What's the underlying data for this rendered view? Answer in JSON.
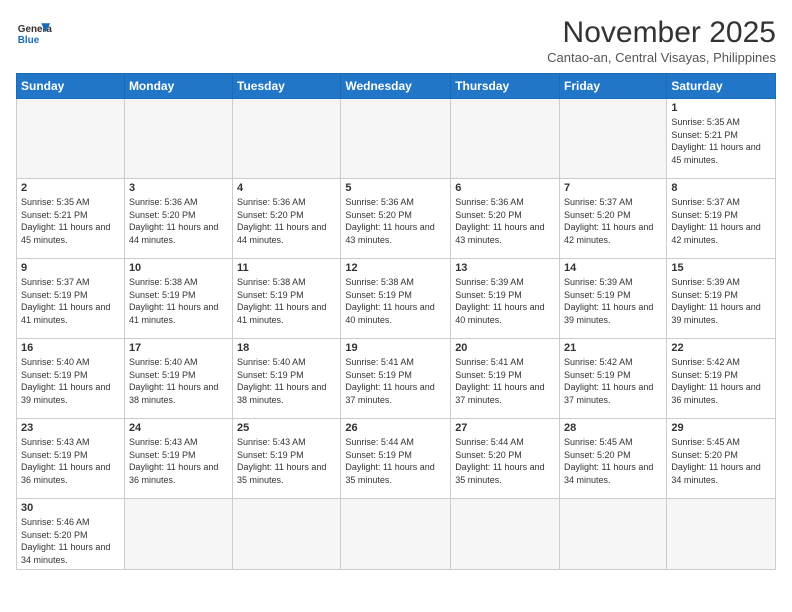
{
  "logo": {
    "line1": "General",
    "line2": "Blue"
  },
  "title": "November 2025",
  "location": "Cantao-an, Central Visayas, Philippines",
  "weekdays": [
    "Sunday",
    "Monday",
    "Tuesday",
    "Wednesday",
    "Thursday",
    "Friday",
    "Saturday"
  ],
  "days": {
    "d1": {
      "num": "1",
      "sunrise": "5:35 AM",
      "sunset": "5:21 PM",
      "daylight": "11 hours and 45 minutes."
    },
    "d2": {
      "num": "2",
      "sunrise": "5:35 AM",
      "sunset": "5:21 PM",
      "daylight": "11 hours and 45 minutes."
    },
    "d3": {
      "num": "3",
      "sunrise": "5:36 AM",
      "sunset": "5:20 PM",
      "daylight": "11 hours and 44 minutes."
    },
    "d4": {
      "num": "4",
      "sunrise": "5:36 AM",
      "sunset": "5:20 PM",
      "daylight": "11 hours and 44 minutes."
    },
    "d5": {
      "num": "5",
      "sunrise": "5:36 AM",
      "sunset": "5:20 PM",
      "daylight": "11 hours and 43 minutes."
    },
    "d6": {
      "num": "6",
      "sunrise": "5:36 AM",
      "sunset": "5:20 PM",
      "daylight": "11 hours and 43 minutes."
    },
    "d7": {
      "num": "7",
      "sunrise": "5:37 AM",
      "sunset": "5:20 PM",
      "daylight": "11 hours and 42 minutes."
    },
    "d8": {
      "num": "8",
      "sunrise": "5:37 AM",
      "sunset": "5:19 PM",
      "daylight": "11 hours and 42 minutes."
    },
    "d9": {
      "num": "9",
      "sunrise": "5:37 AM",
      "sunset": "5:19 PM",
      "daylight": "11 hours and 41 minutes."
    },
    "d10": {
      "num": "10",
      "sunrise": "5:38 AM",
      "sunset": "5:19 PM",
      "daylight": "11 hours and 41 minutes."
    },
    "d11": {
      "num": "11",
      "sunrise": "5:38 AM",
      "sunset": "5:19 PM",
      "daylight": "11 hours and 41 minutes."
    },
    "d12": {
      "num": "12",
      "sunrise": "5:38 AM",
      "sunset": "5:19 PM",
      "daylight": "11 hours and 40 minutes."
    },
    "d13": {
      "num": "13",
      "sunrise": "5:39 AM",
      "sunset": "5:19 PM",
      "daylight": "11 hours and 40 minutes."
    },
    "d14": {
      "num": "14",
      "sunrise": "5:39 AM",
      "sunset": "5:19 PM",
      "daylight": "11 hours and 39 minutes."
    },
    "d15": {
      "num": "15",
      "sunrise": "5:39 AM",
      "sunset": "5:19 PM",
      "daylight": "11 hours and 39 minutes."
    },
    "d16": {
      "num": "16",
      "sunrise": "5:40 AM",
      "sunset": "5:19 PM",
      "daylight": "11 hours and 39 minutes."
    },
    "d17": {
      "num": "17",
      "sunrise": "5:40 AM",
      "sunset": "5:19 PM",
      "daylight": "11 hours and 38 minutes."
    },
    "d18": {
      "num": "18",
      "sunrise": "5:40 AM",
      "sunset": "5:19 PM",
      "daylight": "11 hours and 38 minutes."
    },
    "d19": {
      "num": "19",
      "sunrise": "5:41 AM",
      "sunset": "5:19 PM",
      "daylight": "11 hours and 37 minutes."
    },
    "d20": {
      "num": "20",
      "sunrise": "5:41 AM",
      "sunset": "5:19 PM",
      "daylight": "11 hours and 37 minutes."
    },
    "d21": {
      "num": "21",
      "sunrise": "5:42 AM",
      "sunset": "5:19 PM",
      "daylight": "11 hours and 37 minutes."
    },
    "d22": {
      "num": "22",
      "sunrise": "5:42 AM",
      "sunset": "5:19 PM",
      "daylight": "11 hours and 36 minutes."
    },
    "d23": {
      "num": "23",
      "sunrise": "5:43 AM",
      "sunset": "5:19 PM",
      "daylight": "11 hours and 36 minutes."
    },
    "d24": {
      "num": "24",
      "sunrise": "5:43 AM",
      "sunset": "5:19 PM",
      "daylight": "11 hours and 36 minutes."
    },
    "d25": {
      "num": "25",
      "sunrise": "5:43 AM",
      "sunset": "5:19 PM",
      "daylight": "11 hours and 35 minutes."
    },
    "d26": {
      "num": "26",
      "sunrise": "5:44 AM",
      "sunset": "5:19 PM",
      "daylight": "11 hours and 35 minutes."
    },
    "d27": {
      "num": "27",
      "sunrise": "5:44 AM",
      "sunset": "5:20 PM",
      "daylight": "11 hours and 35 minutes."
    },
    "d28": {
      "num": "28",
      "sunrise": "5:45 AM",
      "sunset": "5:20 PM",
      "daylight": "11 hours and 34 minutes."
    },
    "d29": {
      "num": "29",
      "sunrise": "5:45 AM",
      "sunset": "5:20 PM",
      "daylight": "11 hours and 34 minutes."
    },
    "d30": {
      "num": "30",
      "sunrise": "5:46 AM",
      "sunset": "5:20 PM",
      "daylight": "11 hours and 34 minutes."
    }
  },
  "labels": {
    "sunrise": "Sunrise:",
    "sunset": "Sunset:",
    "daylight": "Daylight:"
  }
}
